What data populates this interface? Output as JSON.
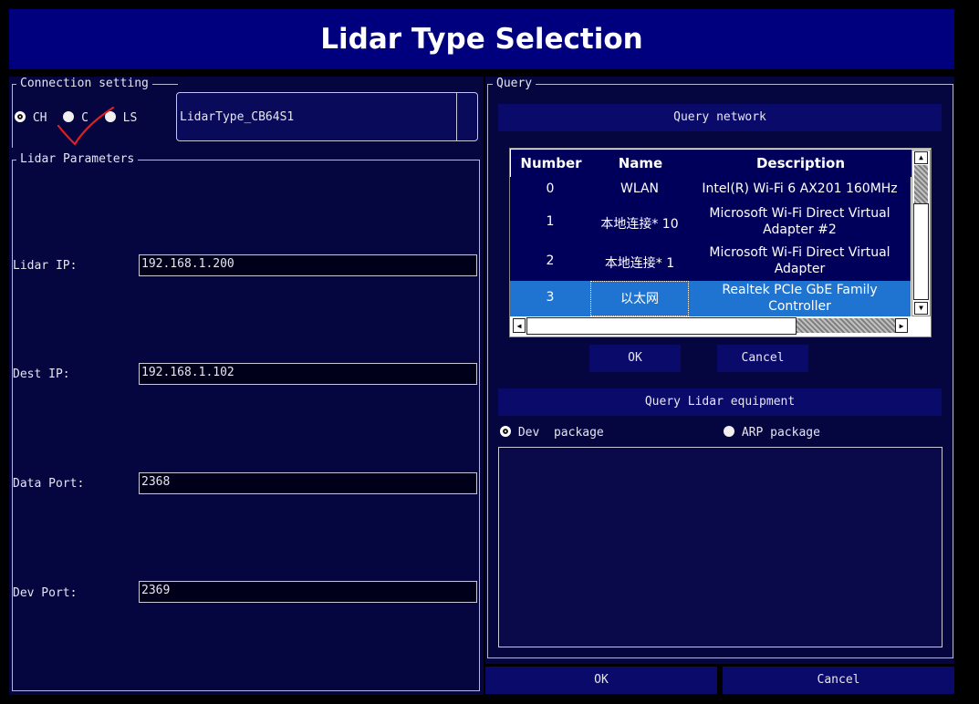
{
  "window": {
    "title": "Lidar Type Selection"
  },
  "connection": {
    "legend": "Connection setting",
    "options": [
      {
        "label": "CH",
        "selected": true
      },
      {
        "label": "C",
        "selected": false
      },
      {
        "label": "LS",
        "selected": false
      }
    ],
    "lidar_type_value": "LidarType_CB64S1"
  },
  "params": {
    "legend": "Lidar Parameters",
    "lidar_ip": {
      "label": "Lidar IP:",
      "value": "192.168.1.200"
    },
    "dest_ip": {
      "label": "Dest IP:",
      "value": "192.168.1.102"
    },
    "data_port": {
      "label": "Data Port:",
      "value": "2368"
    },
    "dev_port": {
      "label": "Dev Port:",
      "value": "2369"
    }
  },
  "query": {
    "legend": "Query",
    "network_button": "Query network",
    "table": {
      "headers": [
        "Number",
        "Name",
        "Description"
      ],
      "rows": [
        {
          "number": "0",
          "name": "WLAN",
          "description": "Intel(R) Wi-Fi 6 AX201 160MHz"
        },
        {
          "number": "1",
          "name": "本地连接* 10",
          "description": "Microsoft Wi-Fi Direct Virtual Adapter #2"
        },
        {
          "number": "2",
          "name": "本地连接* 1",
          "description": "Microsoft Wi-Fi Direct Virtual Adapter"
        },
        {
          "number": "3",
          "name": "以太网",
          "description": "Realtek PCIe GbE Family Controller",
          "selected": true
        }
      ]
    },
    "ok": "OK",
    "cancel": "Cancel",
    "equipment_button": "Query Lidar equipment",
    "packages": [
      {
        "label": "Dev  package",
        "selected": true
      },
      {
        "label": "ARP package",
        "selected": false
      }
    ],
    "result_text": ""
  },
  "footer": {
    "ok": "OK",
    "cancel": "Cancel"
  },
  "annotation": {
    "checkmark_color": "#e02020"
  }
}
